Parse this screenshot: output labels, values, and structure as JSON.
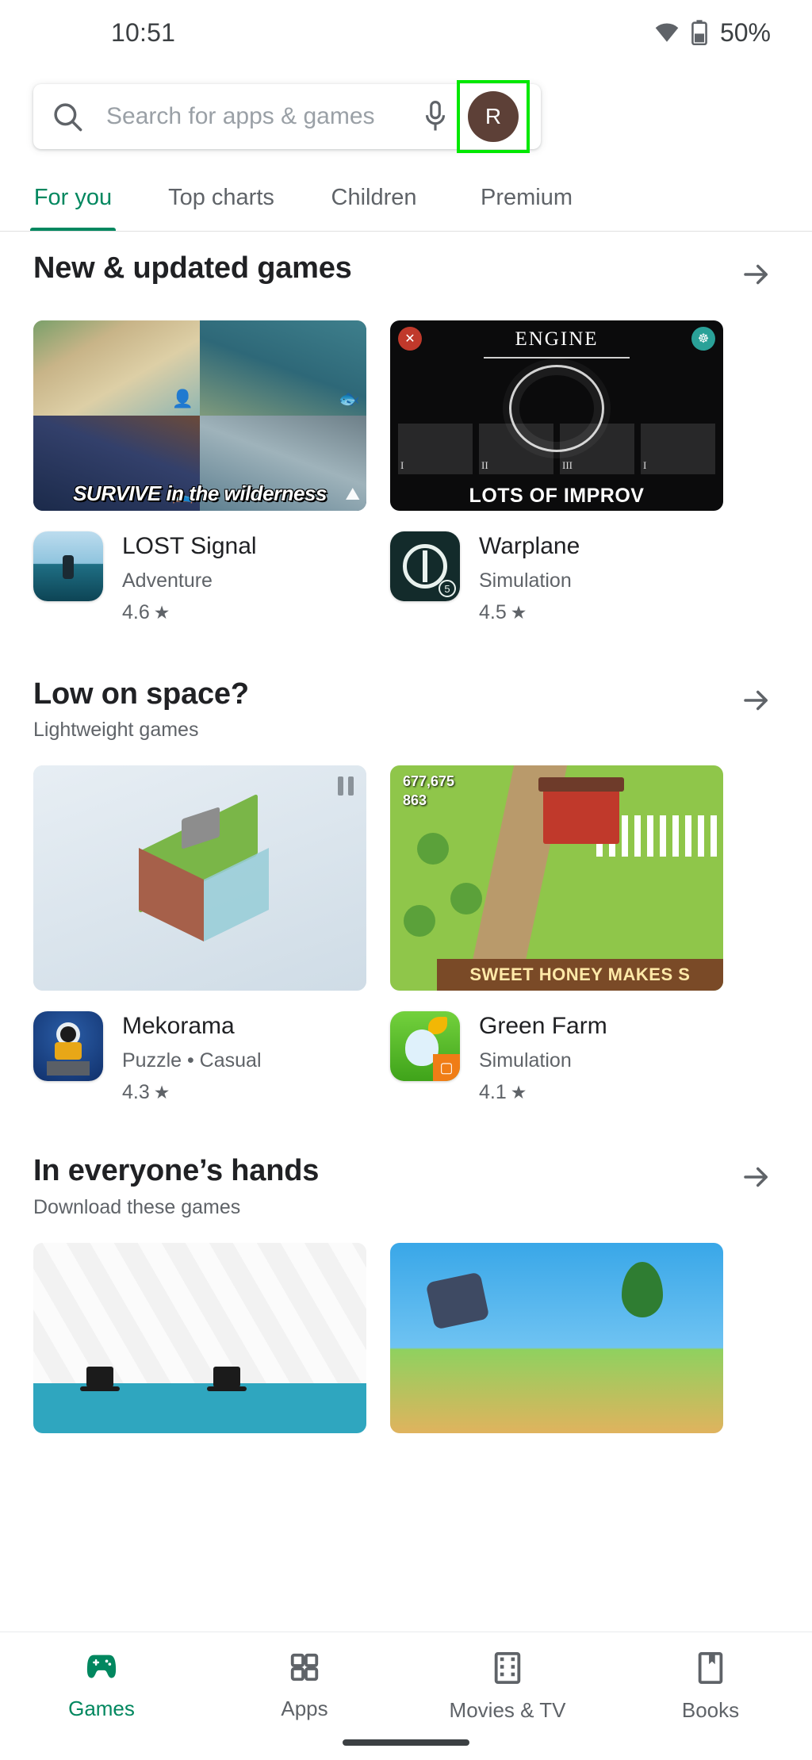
{
  "status_bar": {
    "time": "10:51",
    "wifi_icon": "wifi-icon",
    "battery_icon": "battery-icon",
    "battery_text": "50%"
  },
  "search": {
    "search_icon": "search-icon",
    "placeholder": "Search for apps & games",
    "value": "",
    "mic_icon": "microphone-icon",
    "avatar_initial": "R",
    "avatar_color": "#5d4037",
    "focus_highlight_color": "#00e800"
  },
  "tabs": {
    "accent_color": "#01875f",
    "items": [
      {
        "label": "For you",
        "active": true
      },
      {
        "label": "Top charts",
        "active": false
      },
      {
        "label": "Children",
        "active": false
      },
      {
        "label": "Premium",
        "active": false
      }
    ]
  },
  "clusters": [
    {
      "title": "New & updated games",
      "subtitle": "",
      "more_icon": "arrow-right-icon",
      "cards": [
        {
          "banner_caption": "SURVIVE in the wilderness",
          "app_title": "LOST Signal",
          "genre": "Adventure",
          "rating": "4.6",
          "star_icon": "star-icon"
        },
        {
          "banner_title": "ENGINE",
          "banner_caption": "LOTS OF IMPROV",
          "slot_labels": [
            "I",
            "II",
            "III",
            "I"
          ],
          "app_title": "Warplane",
          "genre": "Simulation",
          "rating": "4.5",
          "star_icon": "star-icon"
        }
      ]
    },
    {
      "title": "Low on space?",
      "subtitle": "Lightweight games",
      "more_icon": "arrow-right-icon",
      "cards": [
        {
          "banner_caption": "",
          "pause_icon": "pause-icon",
          "app_title": "Mekorama",
          "genre": "Puzzle  •  Casual",
          "rating": "4.3",
          "star_icon": "star-icon"
        },
        {
          "banner_caption": "SWEET HONEY MAKES S",
          "coin_value": "677,675",
          "gem_value": "863",
          "app_title": "Green Farm",
          "genre": "Simulation",
          "rating": "4.1",
          "star_icon": "star-icon"
        }
      ]
    },
    {
      "title": "In everyone’s hands",
      "subtitle": "Download these games",
      "more_icon": "arrow-right-icon",
      "cards": [
        {
          "banner_caption": ""
        },
        {
          "banner_caption": ""
        }
      ]
    }
  ],
  "bottom_nav": {
    "active_color": "#01875f",
    "items": [
      {
        "label": "Games",
        "icon": "gamepad-icon",
        "active": true
      },
      {
        "label": "Apps",
        "icon": "grid-icon",
        "active": false
      },
      {
        "label": "Movies & TV",
        "icon": "film-icon",
        "active": false
      },
      {
        "label": "Books",
        "icon": "book-bookmark-icon",
        "active": false
      }
    ]
  }
}
